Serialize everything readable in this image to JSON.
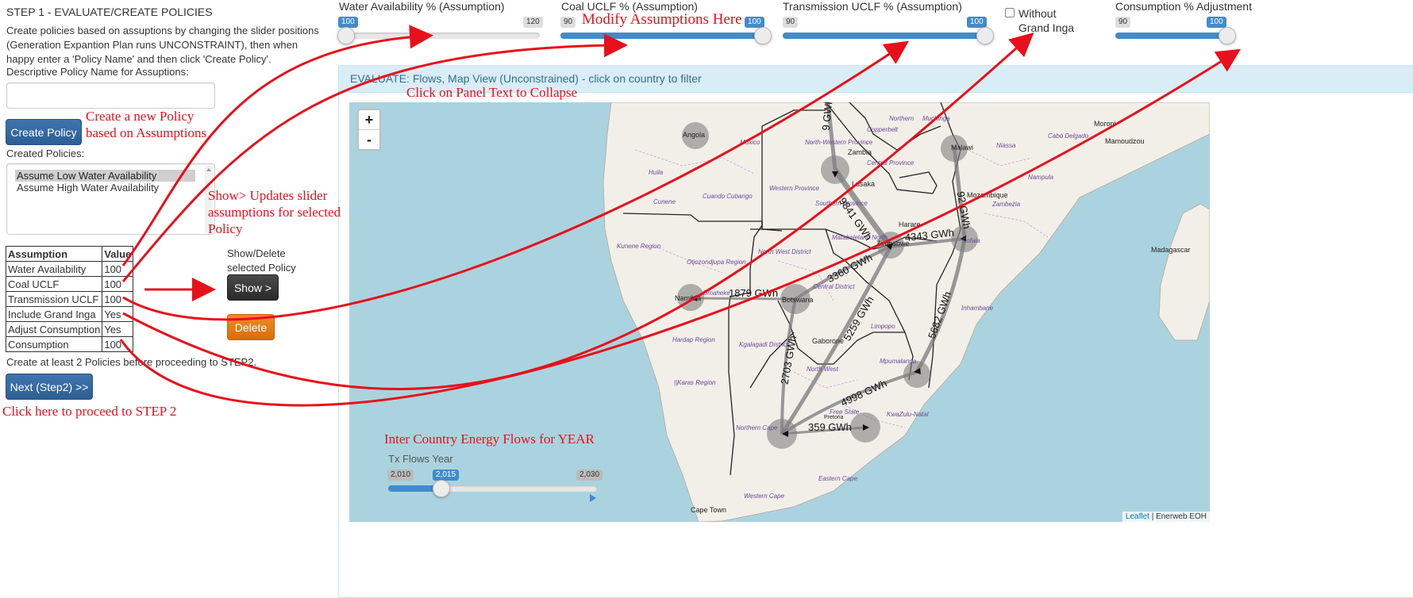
{
  "step": {
    "title": "STEP 1 - EVALUATE/CREATE POLICIES",
    "description": "Create policies based on assuptions by changing the slider positions (Generation Expantion Plan runs UNCONSTRAINT), then when happy enter a 'Policy Name' and then click 'Create Policy'.",
    "name_label": "Descriptive Policy Name for Assuptions:",
    "name_value": "",
    "create_label": "Create Policy",
    "created_label": "Created Policies:",
    "policies": [
      "Assume Low Water Availability",
      "Assume High Water Availability"
    ],
    "selected_policy_index": 0,
    "table_headers": [
      "Assumption",
      "Value"
    ],
    "table_rows": [
      [
        "Water Availability",
        "100"
      ],
      [
        "Coal UCLF",
        "100"
      ],
      [
        "Transmission UCLF",
        "100"
      ],
      [
        "Include Grand Inga",
        "Yes"
      ],
      [
        "Adjust Consumption",
        "Yes"
      ],
      [
        "Consumption",
        "100"
      ]
    ],
    "show_delete_label": "Show/Delete selected Policy",
    "show_label": "Show >",
    "delete_label": "Delete",
    "note": "Create at least 2 Policies before proceeding to STEP2.",
    "next_label": "Next (Step2) >>"
  },
  "sliders": {
    "water": {
      "label": "Water Availability % (Assumption)",
      "min": "100",
      "max": "120",
      "value": "100",
      "fraction": 0.0
    },
    "coal": {
      "label": "Coal UCLF % (Assumption)",
      "min": "90",
      "max": "100",
      "value": "100",
      "fraction": 1.0
    },
    "transmission": {
      "label": "Transmission UCLF % (Assumption)",
      "min": "90",
      "max": "100",
      "value": "100",
      "fraction": 1.0
    },
    "grand_inga": {
      "label": "Without Grand Inga",
      "checked": false
    },
    "consumption": {
      "label": "Consumption % Adjustment",
      "min": "90",
      "max": "100",
      "value": "100",
      "fraction": 1.0
    }
  },
  "panel": {
    "title": "EVALUATE: Flows, Map View (Unconstrained) - click on country to filter",
    "zoom_in": "+",
    "zoom_out": "-",
    "attribution_link": "Leaflet",
    "attribution_rest": " | Enerweb EOH",
    "year_slider": {
      "label": "Tx Flows Year",
      "min": "2,010",
      "max": "2,030",
      "value": "2,015",
      "fraction": 0.25
    }
  },
  "annotations": {
    "modify": "Modify Assumptions Here",
    "collapse": "Click on Panel Text to Collapse",
    "create_policy": "Create a new Policy based on Assumptions",
    "show": "Show> Updates slider assumptions for selected Policy",
    "proceed": "Click here to proceed to STEP 2",
    "inter_country": "Inter Country Energy Flows for YEAR"
  },
  "map": {
    "countries": [
      "Angola",
      "Zambia",
      "Namibia",
      "Botswana",
      "Zimbabwe",
      "Mozambique",
      "Madagascar",
      "Malawi"
    ],
    "cities": [
      "Lusaka",
      "Harare",
      "Gaborone",
      "Cape Town",
      "Moroni",
      "Mamoudzou",
      "Pretoria"
    ],
    "regions": [
      "Moxico",
      "Huila",
      "Cunene",
      "Cuando Cubango",
      "Western Province",
      "Southern Province",
      "Central Province",
      "Copperbelt",
      "Muchinga",
      "Northern",
      "Niassa",
      "Nampula",
      "Zambezia",
      "Sofala",
      "Inhambane",
      "Kunene Region",
      "Otjozondjupa Region",
      "Omaheke",
      "Hardap Region",
      "Kgalagadi District",
      "North West District",
      "Central District",
      "Matabeleland North",
      "Limpopo",
      "Mpumalanga",
      "North West",
      "Free State",
      "KwaZulu-Natal",
      "Northern Cape",
      "Eastern Cape",
      "Western Cape",
      "||Karas Region",
      "Cabo Delgado",
      "North-Western Province"
    ],
    "flows": [
      "9 GWh",
      "9841 GWh",
      "92 GWh",
      "4343 GWh",
      "3360 GWh",
      "1879 GWh",
      "5682 GWh",
      "5259 GWh",
      "2703 GWh",
      "4998 GWh",
      "359 GWh"
    ]
  },
  "colors": {
    "accent": "#428bca",
    "annotation": "#e8101a",
    "panel_header": "#d9edf7",
    "sea": "#aad3df",
    "land": "#f2efe9"
  }
}
